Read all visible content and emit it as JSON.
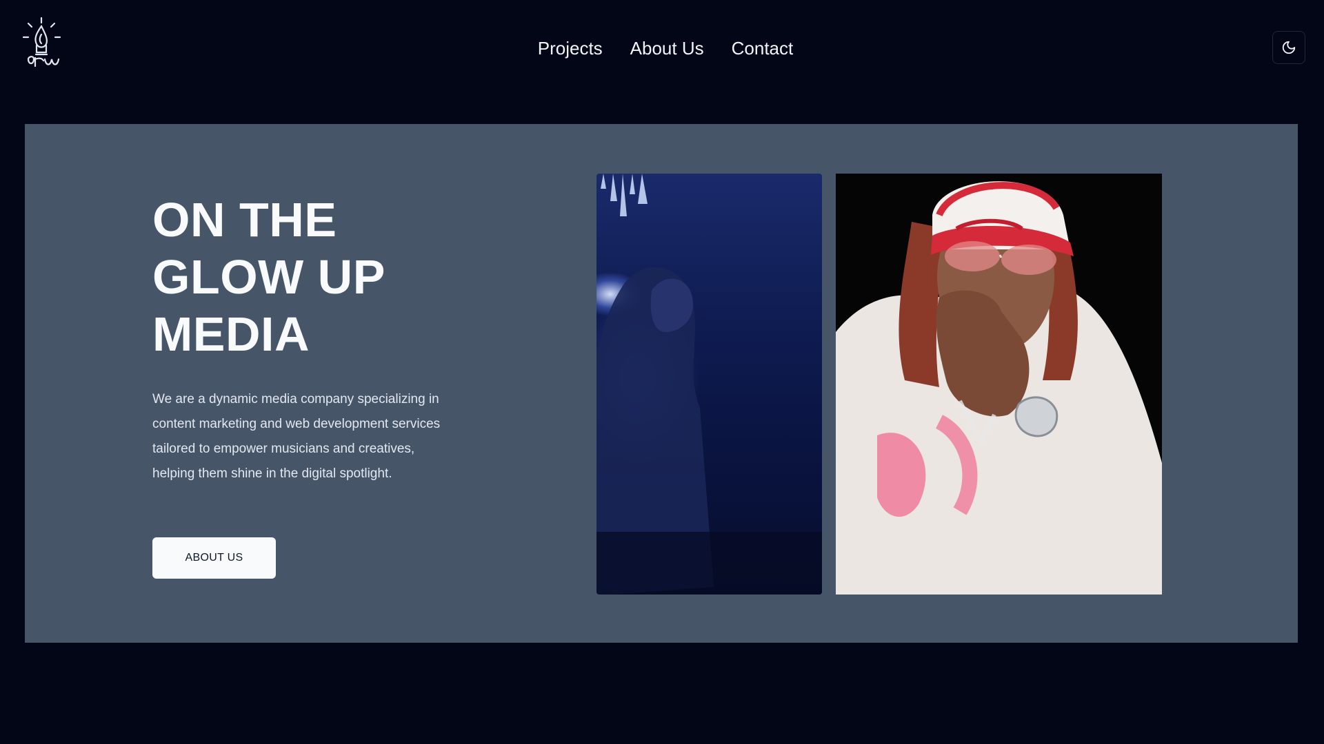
{
  "header": {
    "logo_icon": "lightbulb-logo-icon",
    "nav": [
      {
        "label": "Projects"
      },
      {
        "label": "About Us"
      },
      {
        "label": "Contact"
      }
    ],
    "theme_toggle_icon": "moon-icon"
  },
  "hero": {
    "title_lines": [
      "ON THE",
      "GLOW UP",
      "MEDIA"
    ],
    "description": "We are a dynamic media company specializing in content marketing and web development services tailored to empower musicians and creatives, helping them shine in the digital spotlight.",
    "cta_label": "ABOUT US",
    "images": [
      {
        "name": "concert-photo",
        "desc_icon": "photo"
      },
      {
        "name": "artist-portrait-photo",
        "desc_icon": "photo"
      }
    ]
  },
  "colors": {
    "page_bg": "#020617",
    "hero_bg": "#475569",
    "text": "#f8fafc",
    "button_bg": "#f8fafc",
    "button_text": "#0f172a"
  }
}
